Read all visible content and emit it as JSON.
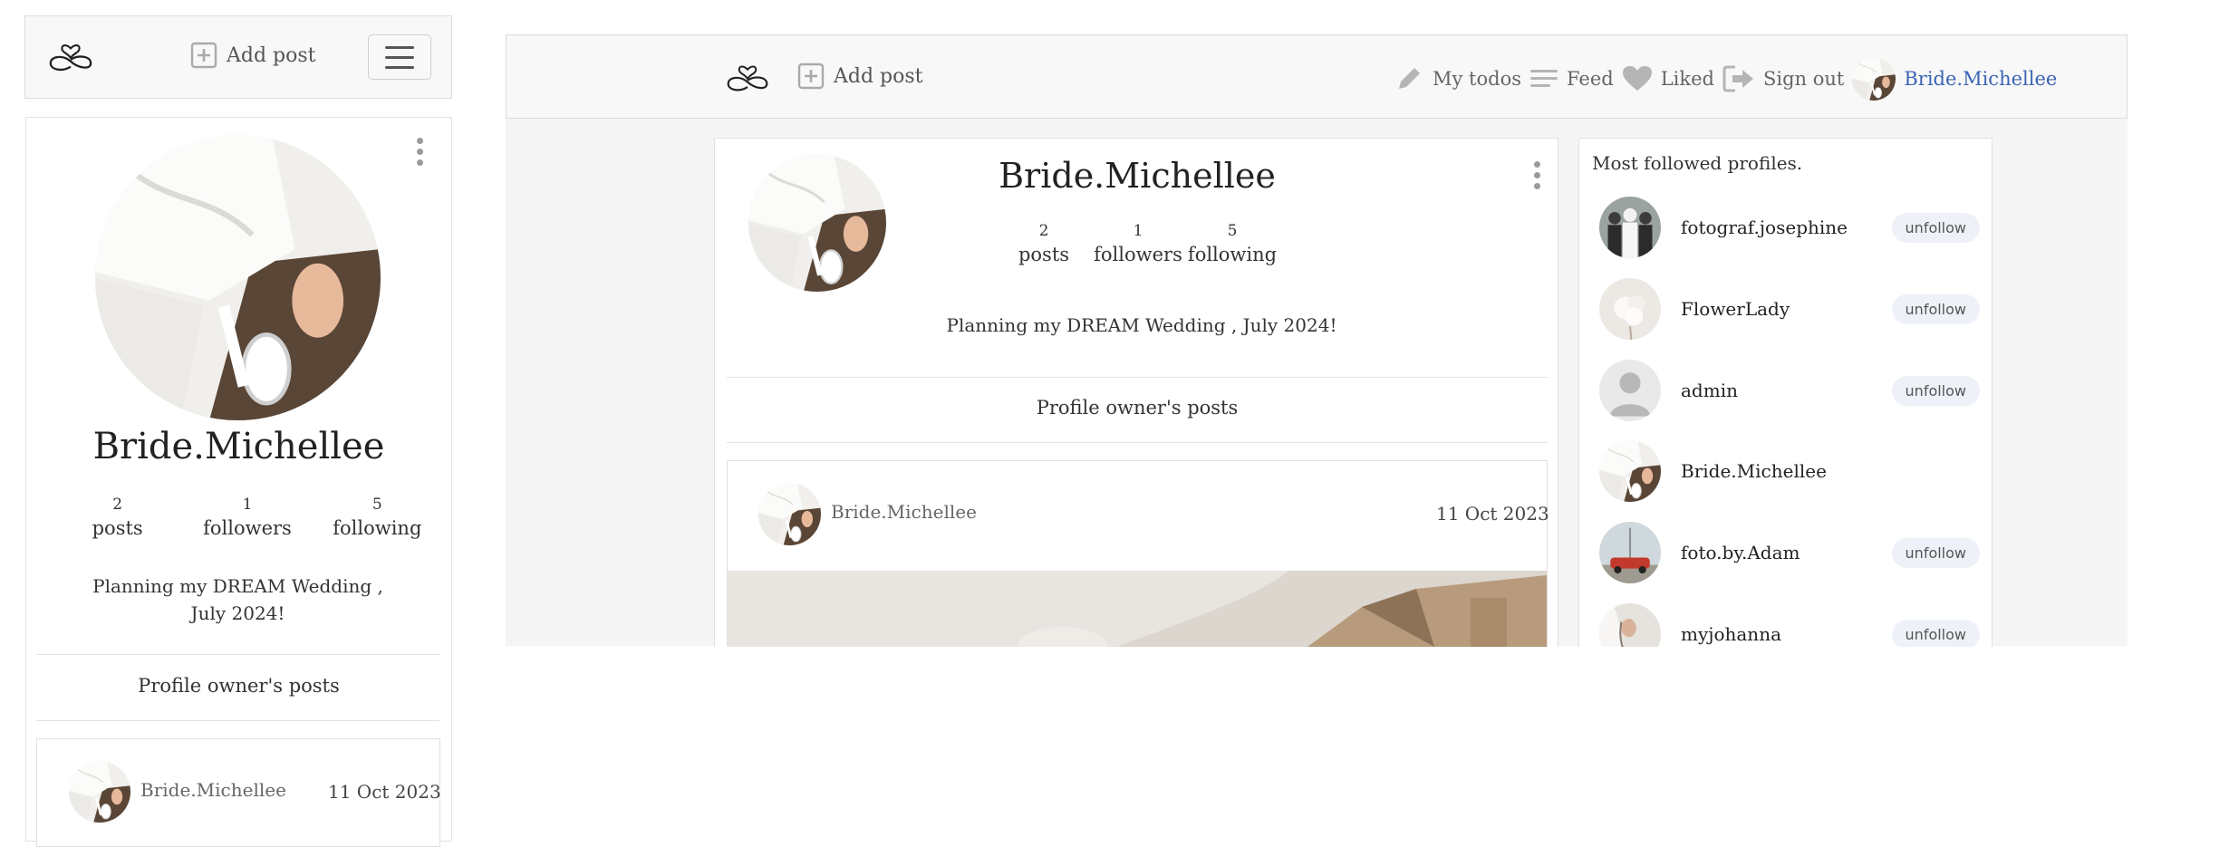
{
  "mobile": {
    "add_post": "Add post",
    "profile": {
      "username": "Bride.Michellee",
      "stats": [
        {
          "num": "2",
          "label": "posts"
        },
        {
          "num": "1",
          "label": "followers"
        },
        {
          "num": "5",
          "label": "following"
        }
      ],
      "bio": "Planning my DREAM Wedding , July 2024!"
    },
    "section_label": "Profile owner's posts",
    "post": {
      "author": "Bride.Michellee",
      "date": "11 Oct 2023"
    }
  },
  "desktop": {
    "nav": {
      "add_post": "Add post",
      "my_todos": "My todos",
      "feed": "Feed",
      "liked": "Liked",
      "sign_out": "Sign out",
      "user": "Bride.Michellee"
    },
    "profile": {
      "username": "Bride.Michellee",
      "stats": [
        {
          "num": "2",
          "label": "posts"
        },
        {
          "num": "1",
          "label": "followers"
        },
        {
          "num": "5",
          "label": "following"
        }
      ],
      "bio": "Planning my DREAM Wedding , July 2024!"
    },
    "section_label": "Profile owner's posts",
    "post": {
      "author": "Bride.Michellee",
      "date": "11 Oct 2023"
    },
    "sidebar": {
      "title": "Most followed profiles.",
      "profiles": [
        {
          "name": "fotograf.josephine",
          "button": "unfollow"
        },
        {
          "name": "FlowerLady",
          "button": "unfollow"
        },
        {
          "name": "admin",
          "button": "unfollow"
        },
        {
          "name": "Bride.Michellee",
          "button": ""
        },
        {
          "name": "foto.by.Adam",
          "button": "unfollow"
        },
        {
          "name": "myjohanna",
          "button": "unfollow"
        }
      ]
    }
  },
  "colors": {
    "accent_link": "#3b63b4",
    "unfollow_bg": "#eef2f8"
  }
}
